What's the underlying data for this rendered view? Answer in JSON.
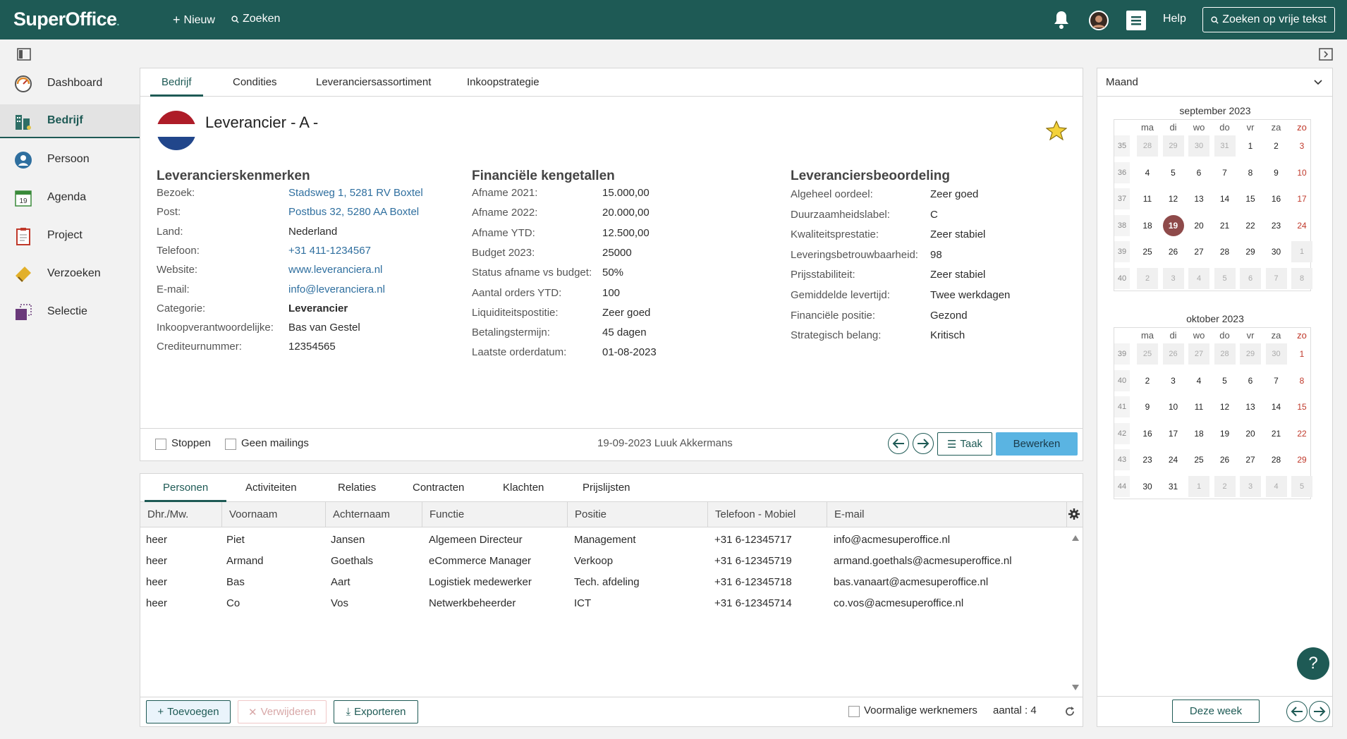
{
  "topbar": {
    "logo": "SuperOffice",
    "new_label": "Nieuw",
    "search_label": "Zoeken",
    "help_label": "Help",
    "free_search_label": "Zoeken op vrije tekst"
  },
  "sidebar": {
    "items": [
      {
        "label": "Dashboard",
        "icon": "gauge-icon"
      },
      {
        "label": "Bedrijf",
        "icon": "building-icon"
      },
      {
        "label": "Persoon",
        "icon": "person-icon"
      },
      {
        "label": "Agenda",
        "icon": "calendar-icon"
      },
      {
        "label": "Project",
        "icon": "clipboard-icon"
      },
      {
        "label": "Verzoeken",
        "icon": "ticket-icon"
      },
      {
        "label": "Selectie",
        "icon": "selection-icon"
      }
    ]
  },
  "company": {
    "tabs": [
      "Bedrijf",
      "Condities",
      "Leveranciersassortiment",
      "Inkoopstrategie"
    ],
    "name": "Leverancier - A -",
    "kenmerken": {
      "title": "Leverancierskenmerken",
      "rows": [
        {
          "label": "Bezoek:",
          "value": "Stadsweg 1, 5281 RV Boxtel"
        },
        {
          "label": "Post:",
          "value": "Postbus 32, 5280 AA Boxtel"
        },
        {
          "label": "Land:",
          "value": "Nederland"
        },
        {
          "label": "Telefoon:",
          "value": "+31 411-1234567"
        },
        {
          "label": "Website:",
          "value": "www.leveranciera.nl"
        },
        {
          "label": "E-mail:",
          "value": "info@leveranciera.nl"
        },
        {
          "label": "Categorie:",
          "value": "Leverancier"
        },
        {
          "label": "Inkoopverantwoordelijke:",
          "value": "Bas van Gestel"
        },
        {
          "label": "Crediteurnummer:",
          "value": "12354565"
        }
      ]
    },
    "financieel": {
      "title": "Financiële kengetallen",
      "rows": [
        {
          "label": "Afname 2021:",
          "value": "15.000,00"
        },
        {
          "label": "Afname 2022:",
          "value": "20.000,00"
        },
        {
          "label": "Afname YTD:",
          "value": "12.500,00"
        },
        {
          "label": "Budget 2023:",
          "value": "25000"
        },
        {
          "label": "Status afname vs budget:",
          "value": "50%"
        },
        {
          "label": "Aantal orders YTD:",
          "value": "100"
        },
        {
          "label": "Liquiditeitspostitie:",
          "value": "Zeer goed"
        },
        {
          "label": "Betalingstermijn:",
          "value": "45 dagen"
        },
        {
          "label": "Laatste orderdatum:",
          "value": "01-08-2023"
        }
      ]
    },
    "beoordeling": {
      "title": "Leveranciersbeoordeling",
      "rows": [
        {
          "label": "Algeheel oordeel:",
          "value": "Zeer goed"
        },
        {
          "label": "Duurzaamheidslabel:",
          "value": "C"
        },
        {
          "label": "Kwaliteitsprestatie:",
          "value": "Zeer stabiel"
        },
        {
          "label": "Leveringsbetrouwbaarheid:",
          "value": "98"
        },
        {
          "label": "Prijsstabiliteit:",
          "value": "Zeer stabiel"
        },
        {
          "label": "Gemiddelde levertijd:",
          "value": "Twee werkdagen"
        },
        {
          "label": "Financiële positie:",
          "value": "Gezond"
        },
        {
          "label": "Strategisch belang:",
          "value": "Kritisch"
        }
      ]
    },
    "footer": {
      "stop_label": "Stoppen",
      "no_mailings_label": "Geen mailings",
      "updated": "19-09-2023 Luuk Akkermans",
      "task_label": "Taak",
      "edit_label": "Bewerken"
    }
  },
  "persons": {
    "tabs": [
      "Personen",
      "Activiteiten",
      "Relaties",
      "Contracten",
      "Klachten",
      "Prijslijsten"
    ],
    "columns": [
      "Dhr./Mw.",
      "Voornaam",
      "Achternaam",
      "Functie",
      "Positie",
      "Telefoon - Mobiel",
      "E-mail"
    ],
    "rows": [
      [
        "heer",
        "Piet",
        "Jansen",
        "Algemeen Directeur",
        "Management",
        "+31 6-12345717",
        "info@acmesuperoffice.nl"
      ],
      [
        "heer",
        "Armand",
        "Goethals",
        "eCommerce Manager",
        "Verkoop",
        "+31 6-12345719",
        "armand.goethals@acmesuperoffice.nl"
      ],
      [
        "heer",
        "Bas",
        "Aart",
        "Logistiek medewerker",
        "Tech. afdeling",
        "+31 6-12345718",
        "bas.vanaart@acmesuperoffice.nl"
      ],
      [
        "heer",
        "Co",
        "Vos",
        "Netwerkbeheerder",
        "ICT",
        "+31 6-12345714",
        "co.vos@acmesuperoffice.nl"
      ]
    ],
    "add_label": "Toevoegen",
    "delete_label": "Verwijderen",
    "export_label": "Exporteren",
    "former_label": "Voormalige werknemers",
    "count_label": "aantal : 4"
  },
  "calendar": {
    "view_select": "Maand",
    "day_headers": [
      "ma",
      "di",
      "wo",
      "do",
      "vr",
      "za",
      "zo"
    ],
    "months": [
      {
        "title": "september 2023",
        "weeks": [
          {
            "wk": "35",
            "days": [
              "28",
              "29",
              "30",
              "31",
              "1",
              "2",
              "3"
            ],
            "grey": [
              0,
              1,
              2,
              3
            ]
          },
          {
            "wk": "36",
            "days": [
              "4",
              "5",
              "6",
              "7",
              "8",
              "9",
              "10"
            ],
            "grey": []
          },
          {
            "wk": "37",
            "days": [
              "11",
              "12",
              "13",
              "14",
              "15",
              "16",
              "17"
            ],
            "grey": []
          },
          {
            "wk": "38",
            "days": [
              "18",
              "19",
              "20",
              "21",
              "22",
              "23",
              "24"
            ],
            "grey": []
          },
          {
            "wk": "39",
            "days": [
              "25",
              "26",
              "27",
              "28",
              "29",
              "30",
              "1"
            ],
            "grey": [
              6
            ]
          },
          {
            "wk": "40",
            "days": [
              "2",
              "3",
              "4",
              "5",
              "6",
              "7",
              "8"
            ],
            "grey": [
              0,
              1,
              2,
              3,
              4,
              5,
              6
            ]
          }
        ]
      },
      {
        "title": "oktober 2023",
        "weeks": [
          {
            "wk": "39",
            "days": [
              "25",
              "26",
              "27",
              "28",
              "29",
              "30",
              "1"
            ],
            "grey": [
              0,
              1,
              2,
              3,
              4,
              5
            ]
          },
          {
            "wk": "40",
            "days": [
              "2",
              "3",
              "4",
              "5",
              "6",
              "7",
              "8"
            ],
            "grey": []
          },
          {
            "wk": "41",
            "days": [
              "9",
              "10",
              "11",
              "12",
              "13",
              "14",
              "15"
            ],
            "grey": []
          },
          {
            "wk": "42",
            "days": [
              "16",
              "17",
              "18",
              "19",
              "20",
              "21",
              "22"
            ],
            "grey": []
          },
          {
            "wk": "43",
            "days": [
              "23",
              "24",
              "25",
              "26",
              "27",
              "28",
              "29"
            ],
            "grey": []
          },
          {
            "wk": "44",
            "days": [
              "30",
              "31",
              "1",
              "2",
              "3",
              "4",
              "5"
            ],
            "grey": [
              2,
              3,
              4,
              5,
              6
            ]
          }
        ]
      }
    ],
    "this_week_label": "Deze week",
    "help_icon_label": "?"
  },
  "colors": {
    "brand": "#1e5a55",
    "primary_button": "#5ab4e2",
    "link": "#2f6f9f",
    "today": "#8e4a4a"
  }
}
